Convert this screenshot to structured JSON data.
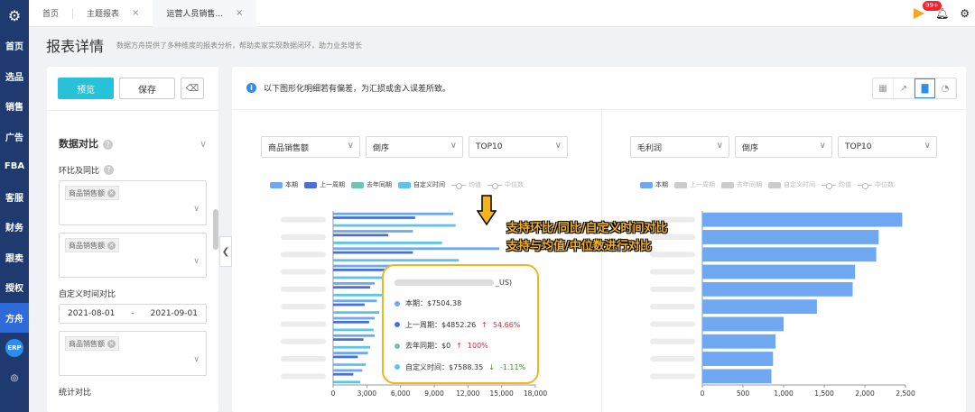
{
  "nav": {
    "items": [
      "首页",
      "选品",
      "销售",
      "广告",
      "FBA",
      "客服",
      "财务",
      "跟卖",
      "授权",
      "方舟"
    ],
    "active": "方舟",
    "erp": "ERP"
  },
  "tabs": [
    {
      "label": "首页",
      "closable": false
    },
    {
      "label": "主题报表",
      "closable": true
    },
    {
      "label": "运营人员销售...",
      "closable": true
    }
  ],
  "topright": {
    "badge": "99+"
  },
  "header": {
    "title": "报表详情",
    "subtitle": "数据方舟提供了多种维度的报表分析，帮助卖家实现数据闭环，助力业务增长"
  },
  "left": {
    "preview_label": "预览",
    "save_label": "保存",
    "section_title": "数据对比",
    "yoy_label": "环比及同比",
    "custom_label": "自定义时间对比",
    "stat_label": "统计对比",
    "tag1": "商品销售额",
    "tag2": "商品销售额",
    "tag3": "商品销售额",
    "date_start": "2021-08-01",
    "date_sep": "-",
    "date_end": "2021-09-01"
  },
  "notice": "以下图形化明细若有偏差，为汇损或舍入误差所致。",
  "left_chart": {
    "metric": "商品销售额",
    "order": "倒序",
    "top": "TOP10"
  },
  "right_chart": {
    "metric": "毛利润",
    "order": "倒序",
    "top": "TOP10"
  },
  "legend": {
    "current": "本期",
    "prev_week": "上一周期",
    "last_year": "去年同期",
    "custom": "自定义时间",
    "avg": "均值",
    "median": "中位数"
  },
  "tooltip": {
    "title_suffix": "_US)",
    "rows": [
      {
        "label": "本期：$7504.38",
        "change": ""
      },
      {
        "label": "上一周期：$4852.26",
        "change": "54.66%",
        "dir": "up"
      },
      {
        "label": "去年同期：$0",
        "change": "100%",
        "dir": "up"
      },
      {
        "label": "自定义时间：$7588.35",
        "change": "-1.11%",
        "dir": "down"
      }
    ]
  },
  "callout": {
    "line1": "支持环比/同比/自定义时间对比",
    "line2": "支持与均值/中位数进行对比"
  },
  "colors": {
    "current": "#6fa8f0",
    "prev": "#4a6fd9",
    "lastyear": "#6ec4b0",
    "custom": "#5cc4e8",
    "accent": "#f5b41c"
  },
  "chart_data": [
    {
      "type": "bar",
      "orientation": "horizontal",
      "xlim": [
        0,
        18000
      ],
      "ticks": [
        "0",
        "3,000",
        "6,000",
        "9,000",
        "12,000",
        "15,000",
        "18,000"
      ],
      "tick_values": [
        0,
        3000,
        6000,
        9000,
        12000,
        15000,
        18000
      ],
      "series": [
        {
          "name": "本期",
          "values": [
            10700,
            7100,
            14800,
            7500,
            3700,
            3900,
            3700,
            3700,
            3100,
            2600
          ]
        },
        {
          "name": "上一周期",
          "values": [
            7300,
            4900,
            7100,
            4800,
            3300,
            2800,
            3200,
            2700,
            2200,
            1800
          ]
        },
        {
          "name": "去年同期",
          "values": [
            0,
            0,
            0,
            0,
            0,
            0,
            0,
            0,
            0,
            0
          ]
        },
        {
          "name": "自定义时间",
          "values": [
            10900,
            9700,
            11200,
            6800,
            5500,
            4100,
            3600,
            3300,
            2900,
            2400
          ]
        }
      ]
    },
    {
      "type": "bar",
      "orientation": "horizontal",
      "xlim": [
        0,
        2500
      ],
      "ticks": [
        "0",
        "500",
        "1,000",
        "1,500",
        "2,000",
        "2,500"
      ],
      "tick_values": [
        0,
        500,
        1000,
        1500,
        2000,
        2500
      ],
      "series": [
        {
          "name": "本期",
          "values": [
            2460,
            2170,
            2140,
            1880,
            1850,
            1410,
            1000,
            900,
            870,
            850
          ]
        }
      ]
    }
  ]
}
